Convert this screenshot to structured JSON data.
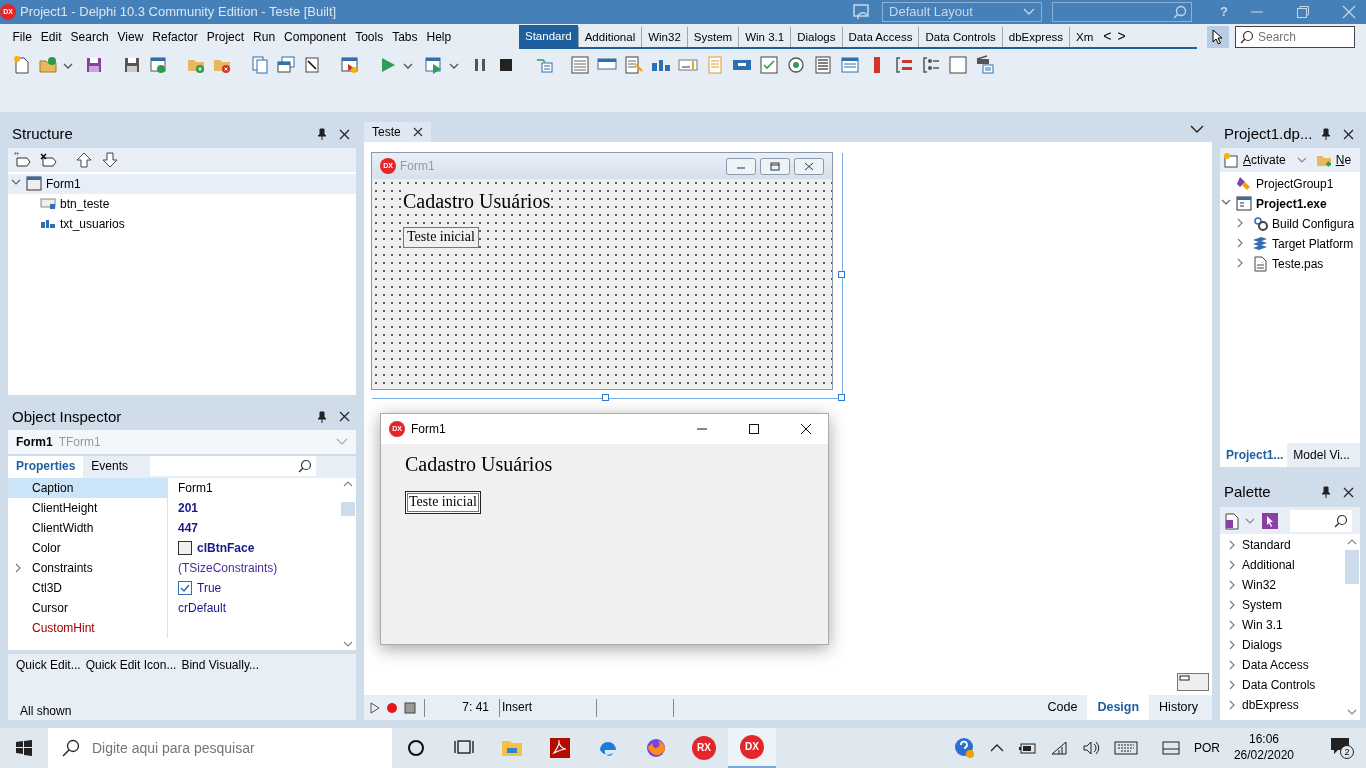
{
  "window": {
    "logo": "DX",
    "title": "Project1 - Delphi 10.3 Community Edition - Teste [Built]",
    "layout": "Default Layout",
    "help": "?"
  },
  "menu": [
    "File",
    "Edit",
    "Search",
    "View",
    "Refactor",
    "Project",
    "Run",
    "Component",
    "Tools",
    "Tabs",
    "Help"
  ],
  "palette_tabs": [
    {
      "label": "Standard",
      "selected": true
    },
    {
      "label": "Additional",
      "selected": false
    },
    {
      "label": "Win32",
      "selected": false
    },
    {
      "label": "System",
      "selected": false
    },
    {
      "label": "Win 3.1",
      "selected": false
    },
    {
      "label": "Dialogs",
      "selected": false
    },
    {
      "label": "Data Access",
      "selected": false
    },
    {
      "label": "Data Controls",
      "selected": false
    },
    {
      "label": "dbExpress",
      "selected": false
    },
    {
      "label": "Xm",
      "selected": false
    }
  ],
  "palette_nav": [
    "<",
    ">"
  ],
  "palette_search": {
    "placeholder": "Search"
  },
  "structure": {
    "title": "Structure",
    "tree": [
      {
        "label": "Form1",
        "kind": "form",
        "selected": true,
        "expanded": true,
        "children": [
          {
            "label": "btn_teste",
            "kind": "button",
            "selected": false
          },
          {
            "label": "txt_usuarios",
            "kind": "label",
            "selected": false
          }
        ]
      }
    ]
  },
  "object_inspector": {
    "title": "Object Inspector",
    "object": "Form1",
    "class": "TForm1",
    "tabs": [
      {
        "label": "Properties",
        "selected": true
      },
      {
        "label": "Events",
        "selected": false
      }
    ],
    "properties": [
      {
        "name": "Caption",
        "value": "Form1",
        "kind": "text",
        "selected": true
      },
      {
        "name": "ClientHeight",
        "value": "201",
        "kind": "modified",
        "selected": false
      },
      {
        "name": "ClientWidth",
        "value": "447",
        "kind": "modified",
        "selected": false
      },
      {
        "name": "Color",
        "value": "clBtnFace",
        "kind": "color",
        "selected": false
      },
      {
        "name": "Constraints",
        "value": "(TSizeConstraints)",
        "kind": "object",
        "selected": false,
        "expanded": false
      },
      {
        "name": "Ctl3D",
        "value": "True",
        "kind": "check",
        "checked": true,
        "selected": false
      },
      {
        "name": "Cursor",
        "value": "crDefault",
        "kind": "default",
        "selected": false
      },
      {
        "name": "CustomHint",
        "kind": "reference",
        "selected": false
      }
    ],
    "actions": [
      "Quick Edit...",
      "Quick Edit Icon...",
      "Bind Visually..."
    ],
    "status": "All shown"
  },
  "editor": {
    "tabs": [
      {
        "label": "Teste",
        "selected": true
      }
    ],
    "designer": {
      "logo": "DX",
      "caption": "Form1",
      "heading": "Cadastro Usuários",
      "button": "Teste inicial"
    },
    "running_form": {
      "logo": "DX",
      "caption": "Form1",
      "heading": "Cadastro Usuários",
      "button": "Teste inicial"
    },
    "status": {
      "position": "7: 41",
      "mode": "Insert"
    },
    "view_tabs": [
      {
        "label": "Code",
        "selected": false
      },
      {
        "label": "Design",
        "selected": true
      },
      {
        "label": "History",
        "selected": false
      }
    ]
  },
  "project": {
    "title": "Project1.dp...",
    "toolbar": [
      "Activate",
      "Ne"
    ],
    "tree": [
      {
        "label": "ProjectGroup1",
        "kind": "group",
        "active": false
      },
      {
        "label": "Project1.exe",
        "kind": "project",
        "active": true,
        "expanded": true,
        "children": [
          {
            "label": "Build Configura",
            "kind": "config",
            "active": false,
            "expanded": false
          },
          {
            "label": "Target Platform",
            "kind": "platforms",
            "active": false,
            "expanded": false
          },
          {
            "label": "Teste.pas",
            "kind": "unit",
            "active": false,
            "expanded": false
          }
        ]
      }
    ],
    "tabs": [
      {
        "label": "Project1...",
        "selected": true
      },
      {
        "label": "Model Vi...",
        "selected": false
      }
    ]
  },
  "palette": {
    "title": "Palette",
    "items": [
      "Standard",
      "Additional",
      "Win32",
      "System",
      "Win 3.1",
      "Dialogs",
      "Data Access",
      "Data Controls",
      "dbExpress"
    ]
  },
  "taskbar": {
    "search_placeholder": "Digite aqui para pesquisar",
    "apps": [
      {
        "kind": "cortana",
        "selected": false
      },
      {
        "kind": "taskview",
        "selected": false
      },
      {
        "kind": "explorer",
        "selected": false
      },
      {
        "kind": "acrobat",
        "selected": false
      },
      {
        "kind": "edge",
        "selected": false
      },
      {
        "kind": "firefox",
        "selected": false
      },
      {
        "kind": "badge",
        "badge": "RX",
        "selected": false
      },
      {
        "kind": "badge",
        "badge": "DX",
        "selected": true
      }
    ],
    "language": "POR",
    "time": "16:06",
    "date": "26/02/2020",
    "notifications": "2"
  }
}
